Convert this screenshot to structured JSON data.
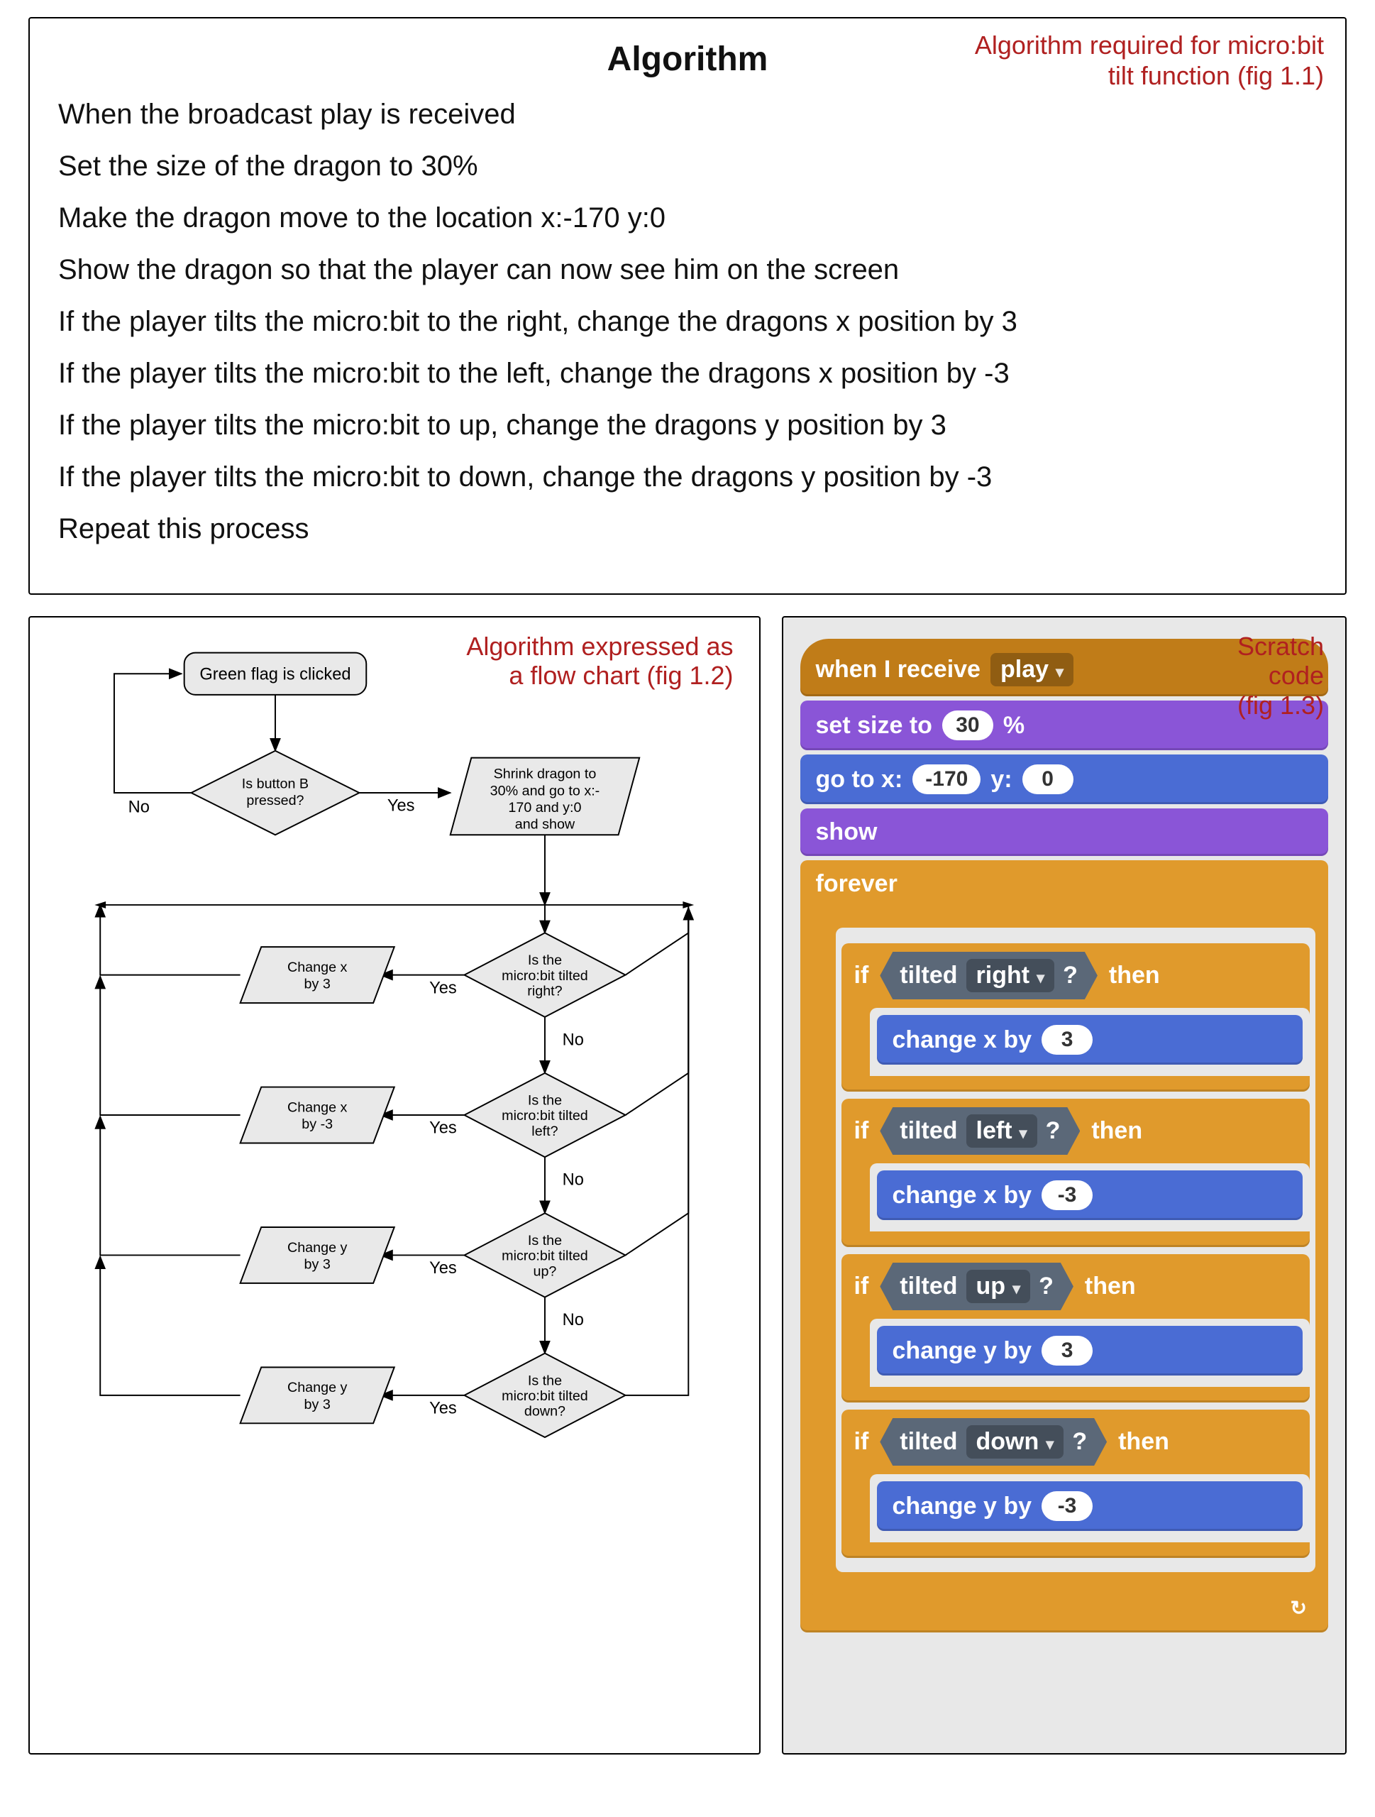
{
  "algorithm": {
    "title": "Algorithm",
    "tag_line1": "Algorithm required for micro:bit",
    "tag_line2": "tilt function (fig 1.1)",
    "lines": [
      "When the broadcast play is received",
      "Set the size of the dragon to 30%",
      "Make the dragon move to the location x:-170 y:0",
      "Show the dragon so that the player can now see him on the screen",
      "If the player  tilts the micro:bit to the right, change the dragons x position by 3",
      "If the player  tilts the micro:bit to the left, change the dragons x position by -3",
      "If the player  tilts the micro:bit to up, change the dragons y position by 3",
      "If the player  tilts the micro:bit to down, change the dragons y position by -3",
      "Repeat this process"
    ]
  },
  "flowchart": {
    "tag_line1": "Algorithm expressed as",
    "tag_line2": "a flow chart (fig 1.2)",
    "start": "Green flag is clicked",
    "decision_b": "Is button B pressed?",
    "process_shrink_l1": "Shrink dragon to",
    "process_shrink_l2": "30% and go to x:-",
    "process_shrink_l3": "170 and y:0",
    "process_shrink_l4": "and show",
    "no": "No",
    "yes": "Yes",
    "branches": [
      {
        "decision_l1": "Is the",
        "decision_l2": "micro:bit tilted",
        "decision_l3": "right?",
        "action_l1": "Change x",
        "action_l2": "by 3"
      },
      {
        "decision_l1": "Is the",
        "decision_l2": "micro:bit tilted",
        "decision_l3": "left?",
        "action_l1": "Change x",
        "action_l2": "by -3"
      },
      {
        "decision_l1": "Is the",
        "decision_l2": "micro:bit tilted",
        "decision_l3": "up?",
        "action_l1": "Change y",
        "action_l2": "by 3"
      },
      {
        "decision_l1": "Is the",
        "decision_l2": "micro:bit tilted",
        "decision_l3": "down?",
        "action_l1": "Change y",
        "action_l2": "by 3"
      }
    ]
  },
  "scratch": {
    "tag_line1": "Scratch",
    "tag_line2": "code",
    "tag_line3": "(fig 1.3)",
    "hat_text": "when I receive",
    "hat_msg": "play",
    "set_size_text": "set size to",
    "set_size_val": "30",
    "set_size_pct": "%",
    "goto_text": "go to x:",
    "goto_x": "-170",
    "goto_y_label": "y:",
    "goto_y": "0",
    "show": "show",
    "forever": "forever",
    "if": "if",
    "then": "then",
    "tilted": "tilted",
    "q": "?",
    "change_x": "change x by",
    "change_y": "change y by",
    "dirs": {
      "right": {
        "name": "right",
        "axis": "x",
        "val": "3"
      },
      "left": {
        "name": "left",
        "axis": "x",
        "val": "-3"
      },
      "up": {
        "name": "up",
        "axis": "y",
        "val": "3"
      },
      "down": {
        "name": "down",
        "axis": "y",
        "val": "-3"
      }
    },
    "loop_arrow": "↻"
  }
}
